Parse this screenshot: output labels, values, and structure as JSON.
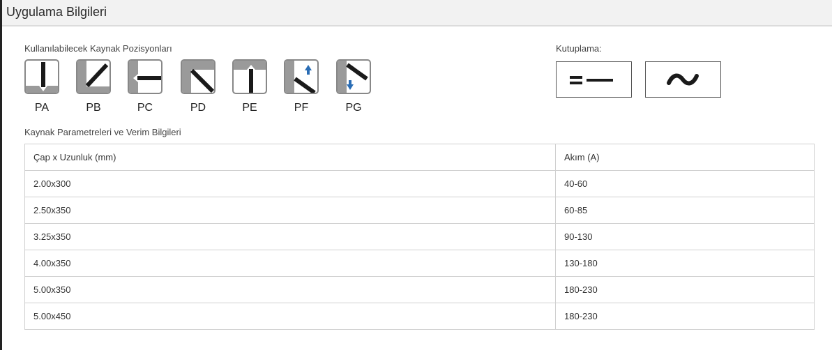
{
  "header": {
    "title": "Uygulama Bilgileri"
  },
  "positions": {
    "label": "Kullanılabilecek Kaynak Pozisyonları",
    "items": [
      {
        "code": "PA",
        "icon": "pa-position-icon"
      },
      {
        "code": "PB",
        "icon": "pb-position-icon"
      },
      {
        "code": "PC",
        "icon": "pc-position-icon"
      },
      {
        "code": "PD",
        "icon": "pd-position-icon"
      },
      {
        "code": "PE",
        "icon": "pe-position-icon"
      },
      {
        "code": "PF",
        "icon": "pf-position-icon"
      },
      {
        "code": "PG",
        "icon": "pg-position-icon"
      }
    ]
  },
  "polarity": {
    "label": "Kutuplama:",
    "options": [
      {
        "icon": "dc-current-icon"
      },
      {
        "icon": "ac-current-icon"
      }
    ]
  },
  "params": {
    "label": "Kaynak Parametreleri ve Verim Bilgileri",
    "columns": [
      "Çap x Uzunluk (mm)",
      "Akım (A)"
    ],
    "rows": [
      [
        "2.00x300",
        "40-60"
      ],
      [
        "2.50x350",
        "60-85"
      ],
      [
        "3.25x350",
        "90-130"
      ],
      [
        "4.00x350",
        "130-180"
      ],
      [
        "5.00x350",
        "180-230"
      ],
      [
        "5.00x450",
        "180-230"
      ]
    ]
  },
  "colors": {
    "header_bg": "#f2f2f2",
    "line": "#222222",
    "arrow": "#2a6db5",
    "panel": "#9a9a9a"
  }
}
